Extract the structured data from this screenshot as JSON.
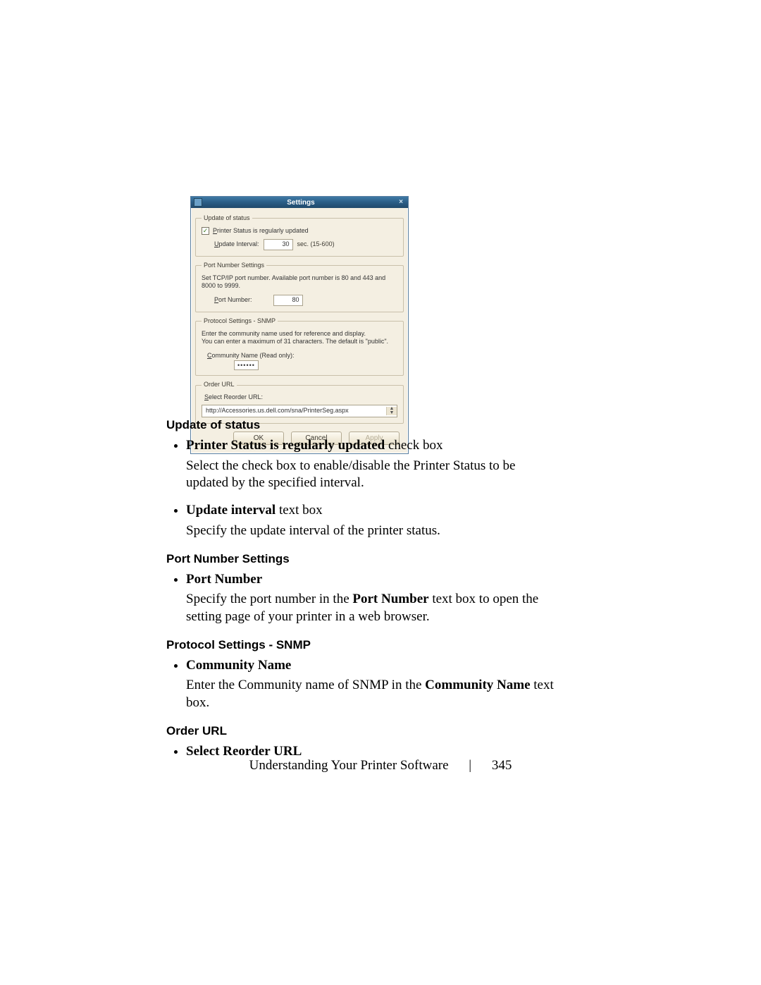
{
  "dialog": {
    "title": "Settings",
    "update_of_status": {
      "legend": "Update of status",
      "checkbox_label_pre_u": "P",
      "checkbox_label_post": "rinter Status is regularly updated",
      "checkbox_checked_glyph": "✓",
      "interval_label_pre": "U",
      "interval_label_post": "pdate Interval:",
      "interval_value": "30",
      "interval_hint": "sec. (15-600)"
    },
    "port": {
      "legend": "Port Number Settings",
      "desc": "Set TCP/IP port number. Available port number is 80 and 443 and 8000 to 9999.",
      "label_pre": "P",
      "label_post": "ort Number:",
      "value": "80"
    },
    "snmp": {
      "legend": "Protocol Settings - SNMP",
      "desc1": "Enter the community name used for reference and display.",
      "desc2": "You can enter a maximum of 31 characters. The default is \"public\".",
      "label_pre": "C",
      "label_post": "ommunity Name (Read only):",
      "value": "••••••"
    },
    "order": {
      "legend": "Order URL",
      "label_pre": "S",
      "label_post": "elect Reorder URL:",
      "value": "http://Accessories.us.dell.com/sna/PrinterSeg.aspx"
    },
    "buttons": {
      "ok": "OK",
      "cancel": "Cancel",
      "apply": "Apply"
    }
  },
  "doc": {
    "h1": "Update of status",
    "s1": {
      "i1_head_bold": "Printer Status is regularly updated ",
      "i1_head_tail": "check box",
      "i1_body": "Select the check box to enable/disable the Printer Status to be updated by the specified interval.",
      "i2_head_bold": "Update interval ",
      "i2_head_tail": "text box",
      "i2_body": "Specify the update interval of the printer status."
    },
    "h2": "Port Number Settings",
    "s2": {
      "i1_head": "Port Number",
      "i1_body_a": "Specify the port number in the ",
      "i1_body_b": "Port Number",
      "i1_body_c": " text box to open the setting page of your printer in a web browser."
    },
    "h3": "Protocol Settings - SNMP",
    "s3": {
      "i1_head": "Community Name",
      "i1_body_a": "Enter the Community name of SNMP in the ",
      "i1_body_b": "Community Name",
      "i1_body_c": " text box."
    },
    "h4": "Order URL",
    "s4": {
      "i1_head": "Select Reorder URL"
    }
  },
  "footer": {
    "section": "Understanding Your Printer Software",
    "page": "345"
  }
}
